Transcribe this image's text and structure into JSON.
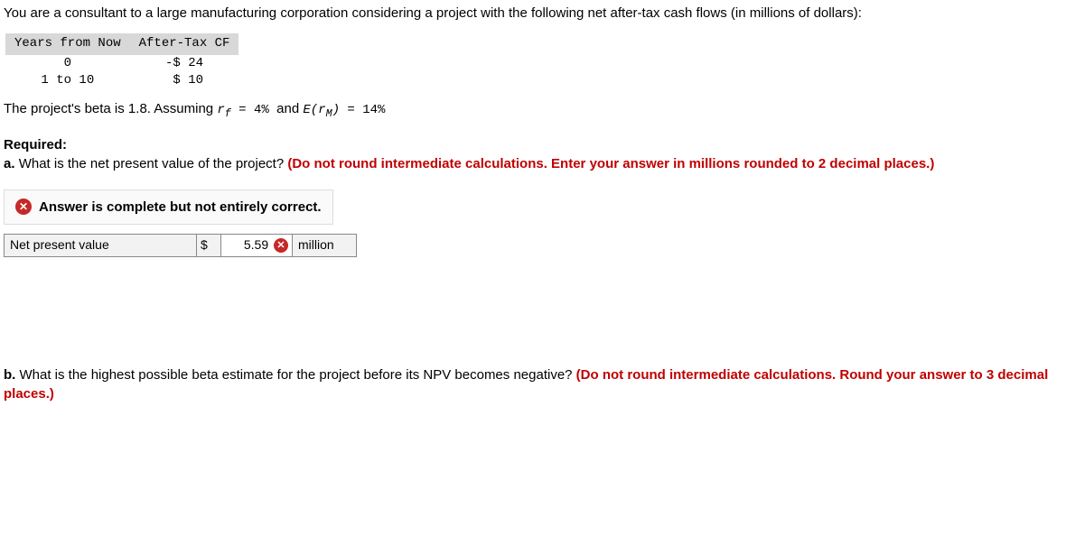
{
  "intro": "You are a consultant to a large manufacturing corporation considering a project with the following net after-tax cash flows (in millions of dollars):",
  "cf_table": {
    "head_years": "Years from Now",
    "head_cf": "After-Tax CF",
    "rows": [
      {
        "years": "0",
        "cf": "-$ 24"
      },
      {
        "years": "1 to 10",
        "cf": " $ 10"
      }
    ]
  },
  "assumption": {
    "prefix": "The project's beta is 1.8. Assuming ",
    "rf": "r",
    "rf_sub": "f",
    "rf_eq": " = 4% ",
    "mid": "and ",
    "erm": "E(r",
    "erm_sub": "M",
    "erm_close": ")",
    "erm_eq": " = 14%"
  },
  "required_label": "Required:",
  "qa": {
    "prefix": "a. ",
    "text": "What is the net present value of the project? ",
    "note": "(Do not round intermediate calculations. Enter your answer in millions rounded to 2 decimal places.)"
  },
  "feedback": {
    "icon": "✕",
    "text": "Answer is complete but not entirely correct."
  },
  "answer": {
    "label": "Net present value",
    "currency": "$",
    "value": "5.59",
    "wrong_icon": "✕",
    "unit": "million"
  },
  "qb": {
    "prefix": "b. ",
    "text": "What is the highest possible beta estimate for the project before its NPV becomes negative? ",
    "note": "(Do not round intermediate calculations. Round your answer to 3 decimal places.)"
  }
}
